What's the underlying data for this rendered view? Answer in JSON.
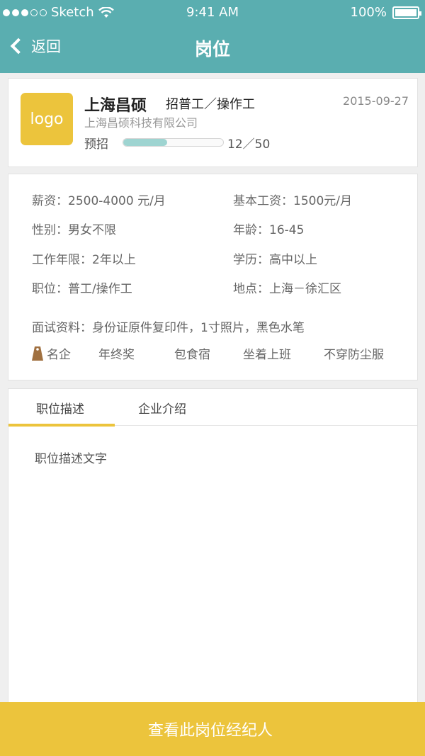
{
  "status_bar": {
    "carrier": "Sketch",
    "time": "9:41 AM",
    "battery": "100%"
  },
  "nav": {
    "back_label": "返回",
    "title": "岗位"
  },
  "job": {
    "logo_text": "logo",
    "company_short": "上海昌硕",
    "title": "招普工／操作工",
    "date": "2015-09-27",
    "company_full": "上海昌硕科技有限公司",
    "quota_label": "预招",
    "quota_count": "12／50",
    "quota_filled_fraction": 0.44
  },
  "details": {
    "salary": "薪资：2500-4000 元/月",
    "base_salary": "基本工资：1500元/月",
    "gender": "性别：男女不限",
    "age": "年龄：16-45",
    "experience": "工作年限：2年以上",
    "education": "学历：高中以上",
    "position": "职位：普工/操作工",
    "location": "地点：上海－徐汇区",
    "interview_docs": "面试资料：身份证原件复印件，1寸照片，黑色水笔",
    "tags": [
      "名企",
      "年终奖",
      "包食宿",
      "坐着上班",
      "不穿防尘服"
    ]
  },
  "tabs": {
    "items": [
      "职位描述",
      "企业介绍"
    ],
    "active_index": 0,
    "content": "职位描述文字"
  },
  "bottom": {
    "button_label": "查看此岗位经纪人"
  },
  "colors": {
    "header": "#5aaeb0",
    "accent": "#ecc43c",
    "progress": "#9ed4d1"
  }
}
